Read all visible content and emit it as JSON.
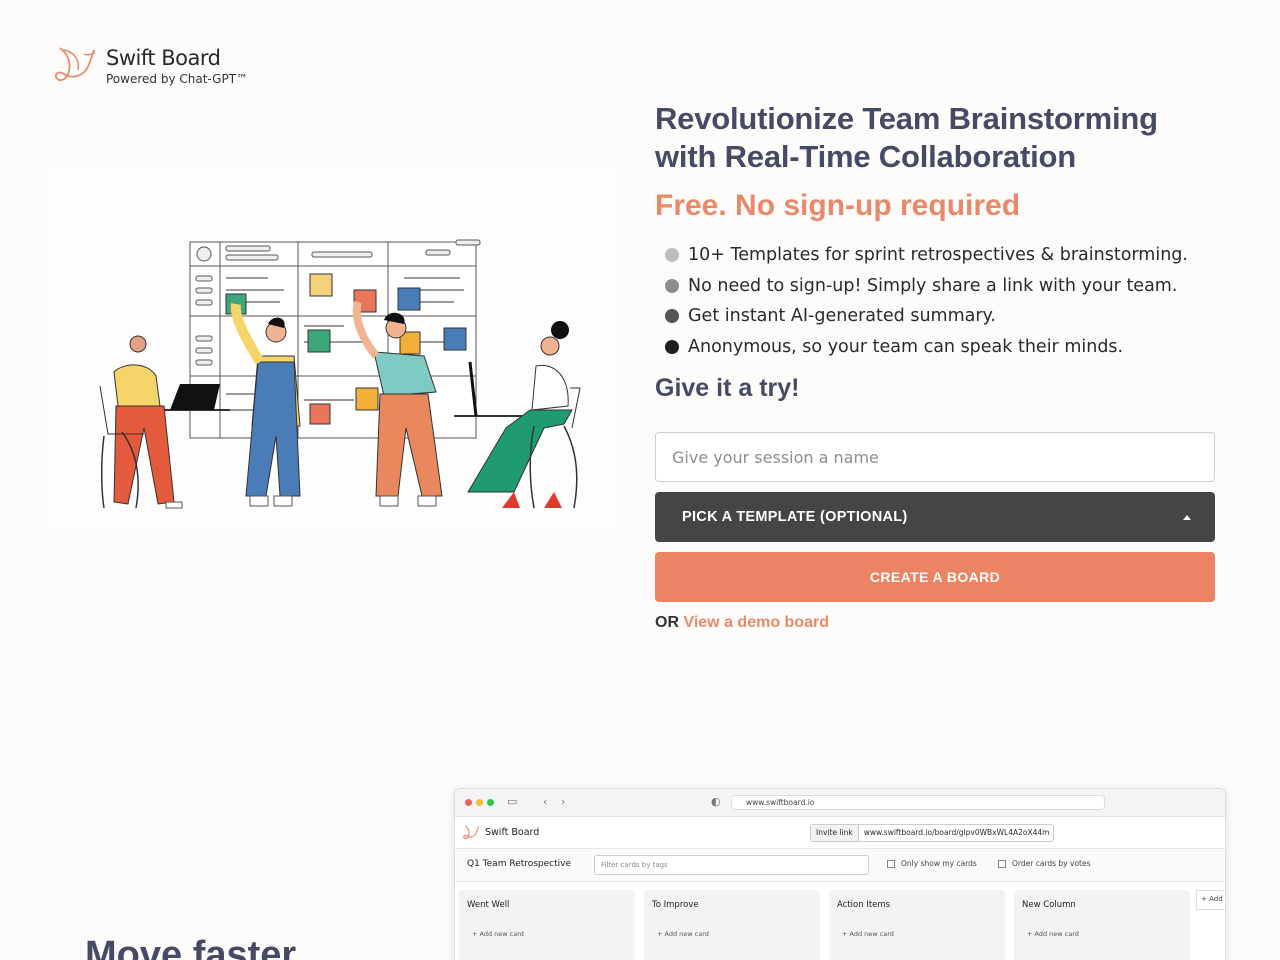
{
  "brand": {
    "name": "Swift Board",
    "tagline": "Powered by Chat-GPT™"
  },
  "hero": {
    "headline_line1": "Revolutionize Team Brainstorming",
    "headline_line2": "with Real-Time Collaboration",
    "subhead": "Free. No sign-up required",
    "features": [
      {
        "text": "10+ Templates for sprint retrospectives & brainstorming.",
        "dot_color": "#bcbcbc"
      },
      {
        "text": "No need to sign-up! Simply share a link with your team.",
        "dot_color": "#8d8d8d"
      },
      {
        "text": "Get instant AI-generated summary.",
        "dot_color": "#555555"
      },
      {
        "text": "Anonymous, so your team can speak their minds.",
        "dot_color": "#1f1f1f"
      }
    ],
    "cta_heading": "Give it a try!"
  },
  "form": {
    "session_name_placeholder": "Give your session a name",
    "session_name_value": "",
    "template_label": "PICK A TEMPLATE (OPTIONAL)",
    "create_label": "CREATE A BOARD",
    "or_text": "OR",
    "demo_link": "View a demo board"
  },
  "colors": {
    "accent": "#ec8463",
    "heading": "#464a64",
    "dark_button": "#474544"
  },
  "section2": {
    "heading": "Move faster"
  },
  "preview": {
    "url": "www.swiftboard.io",
    "app_name": "Swift Board",
    "invite_label": "Invite link",
    "invite_url": "www.swiftboard.io/board/glpv0WBxWL4A2oX44m",
    "board_title": "Q1 Team Retrospective",
    "filter_placeholder": "Filter cards by tags",
    "option1": "Only show my cards",
    "option2": "Order cards by votes",
    "columns": [
      {
        "title": "Went Well",
        "add": "+ Add new card"
      },
      {
        "title": "To Improve",
        "add": "+ Add new card"
      },
      {
        "title": "Action Items",
        "add": "+ Add new card"
      },
      {
        "title": "New Column",
        "add": "+ Add new card"
      }
    ],
    "add_column": "+ Add"
  }
}
